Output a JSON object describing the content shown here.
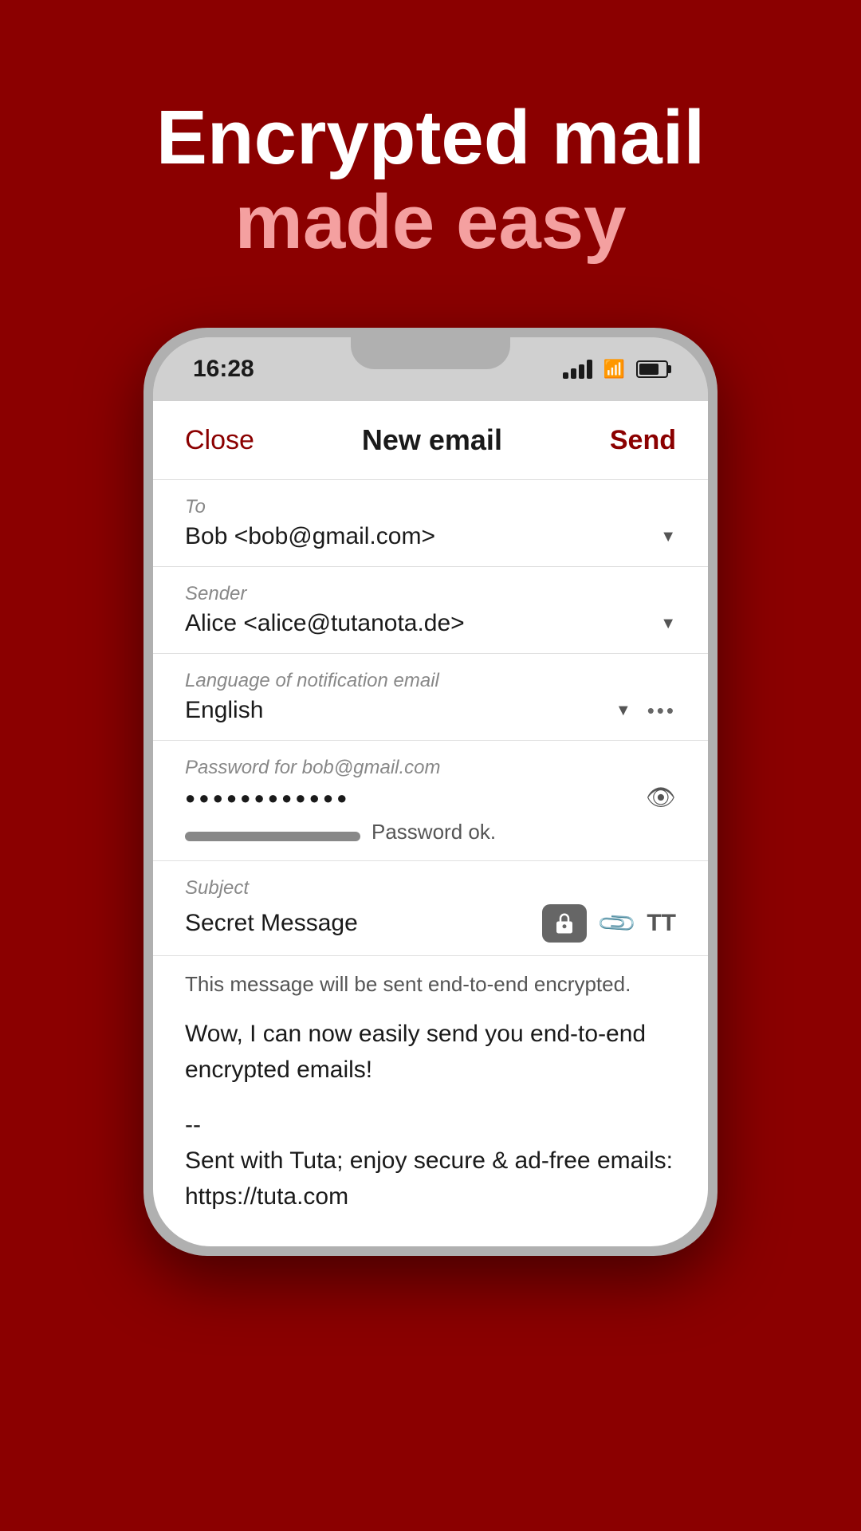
{
  "hero": {
    "line1": "Encrypted mail",
    "line2": "made easy"
  },
  "statusBar": {
    "time": "16:28"
  },
  "composeHeader": {
    "close": "Close",
    "title": "New email",
    "send": "Send"
  },
  "toField": {
    "label": "To",
    "value": "Bob <bob@gmail.com>"
  },
  "senderField": {
    "label": "Sender",
    "value": "Alice <alice@tutanota.de>"
  },
  "languageField": {
    "label": "Language of notification email",
    "value": "English"
  },
  "passwordField": {
    "label": "Password for bob@gmail.com",
    "dots": "●●●●●●●●●●●●",
    "strength": "Password ok."
  },
  "subjectField": {
    "label": "Subject",
    "value": "Secret Message"
  },
  "encryptionNotice": "This message will be sent end-to-end encrypted.",
  "bodyText": "Wow, I can now easily send you end-to-end encrypted emails!",
  "signature": "--\nSent with Tuta; enjoy secure & ad-free emails:\nhttps://tuta.com"
}
